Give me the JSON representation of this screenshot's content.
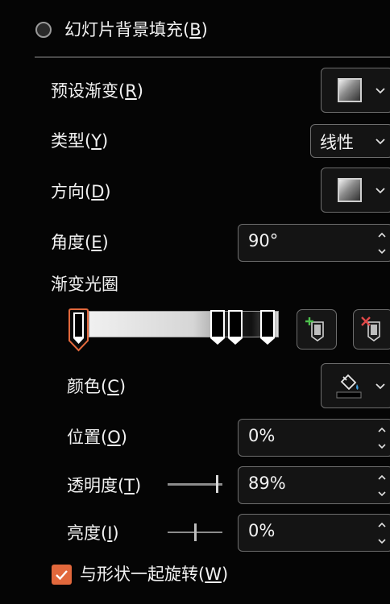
{
  "fill_option": {
    "label": "幻灯片背景填充(",
    "key": "B",
    "suffix": ")"
  },
  "preset": {
    "label": "预设渐变(",
    "key": "R",
    "suffix": ")"
  },
  "type": {
    "label": "类型(",
    "key": "Y",
    "suffix": ")",
    "value": "线性"
  },
  "direction": {
    "label": "方向(",
    "key": "D",
    "suffix": ")"
  },
  "angle": {
    "label": "角度(",
    "key": "E",
    "suffix": ")",
    "value": "90°"
  },
  "gradient_stops": {
    "label": "渐变光圈",
    "add_icon": "add-gradient-stop-icon",
    "remove_icon": "remove-gradient-stop-icon"
  },
  "color": {
    "label": "颜色(",
    "key": "C",
    "suffix": ")",
    "icon": "paint-bucket-icon",
    "swatch": "#000000"
  },
  "position": {
    "label": "位置(",
    "key": "O",
    "suffix": ")",
    "value": "0%"
  },
  "transparency": {
    "label": "透明度(",
    "key": "T",
    "suffix": ")",
    "value": "89%",
    "slider_value": 0.89
  },
  "brightness": {
    "label": "亮度(",
    "key": "I",
    "suffix": ")",
    "value": "0%",
    "slider_value": 0.5
  },
  "rotate_with_shape": {
    "label": "与形状一起旋转(",
    "key": "W",
    "suffix": ")",
    "checked": true
  },
  "colors": {
    "accent": "#e2683c",
    "background": "#050505",
    "border": "#6e6e6e"
  }
}
